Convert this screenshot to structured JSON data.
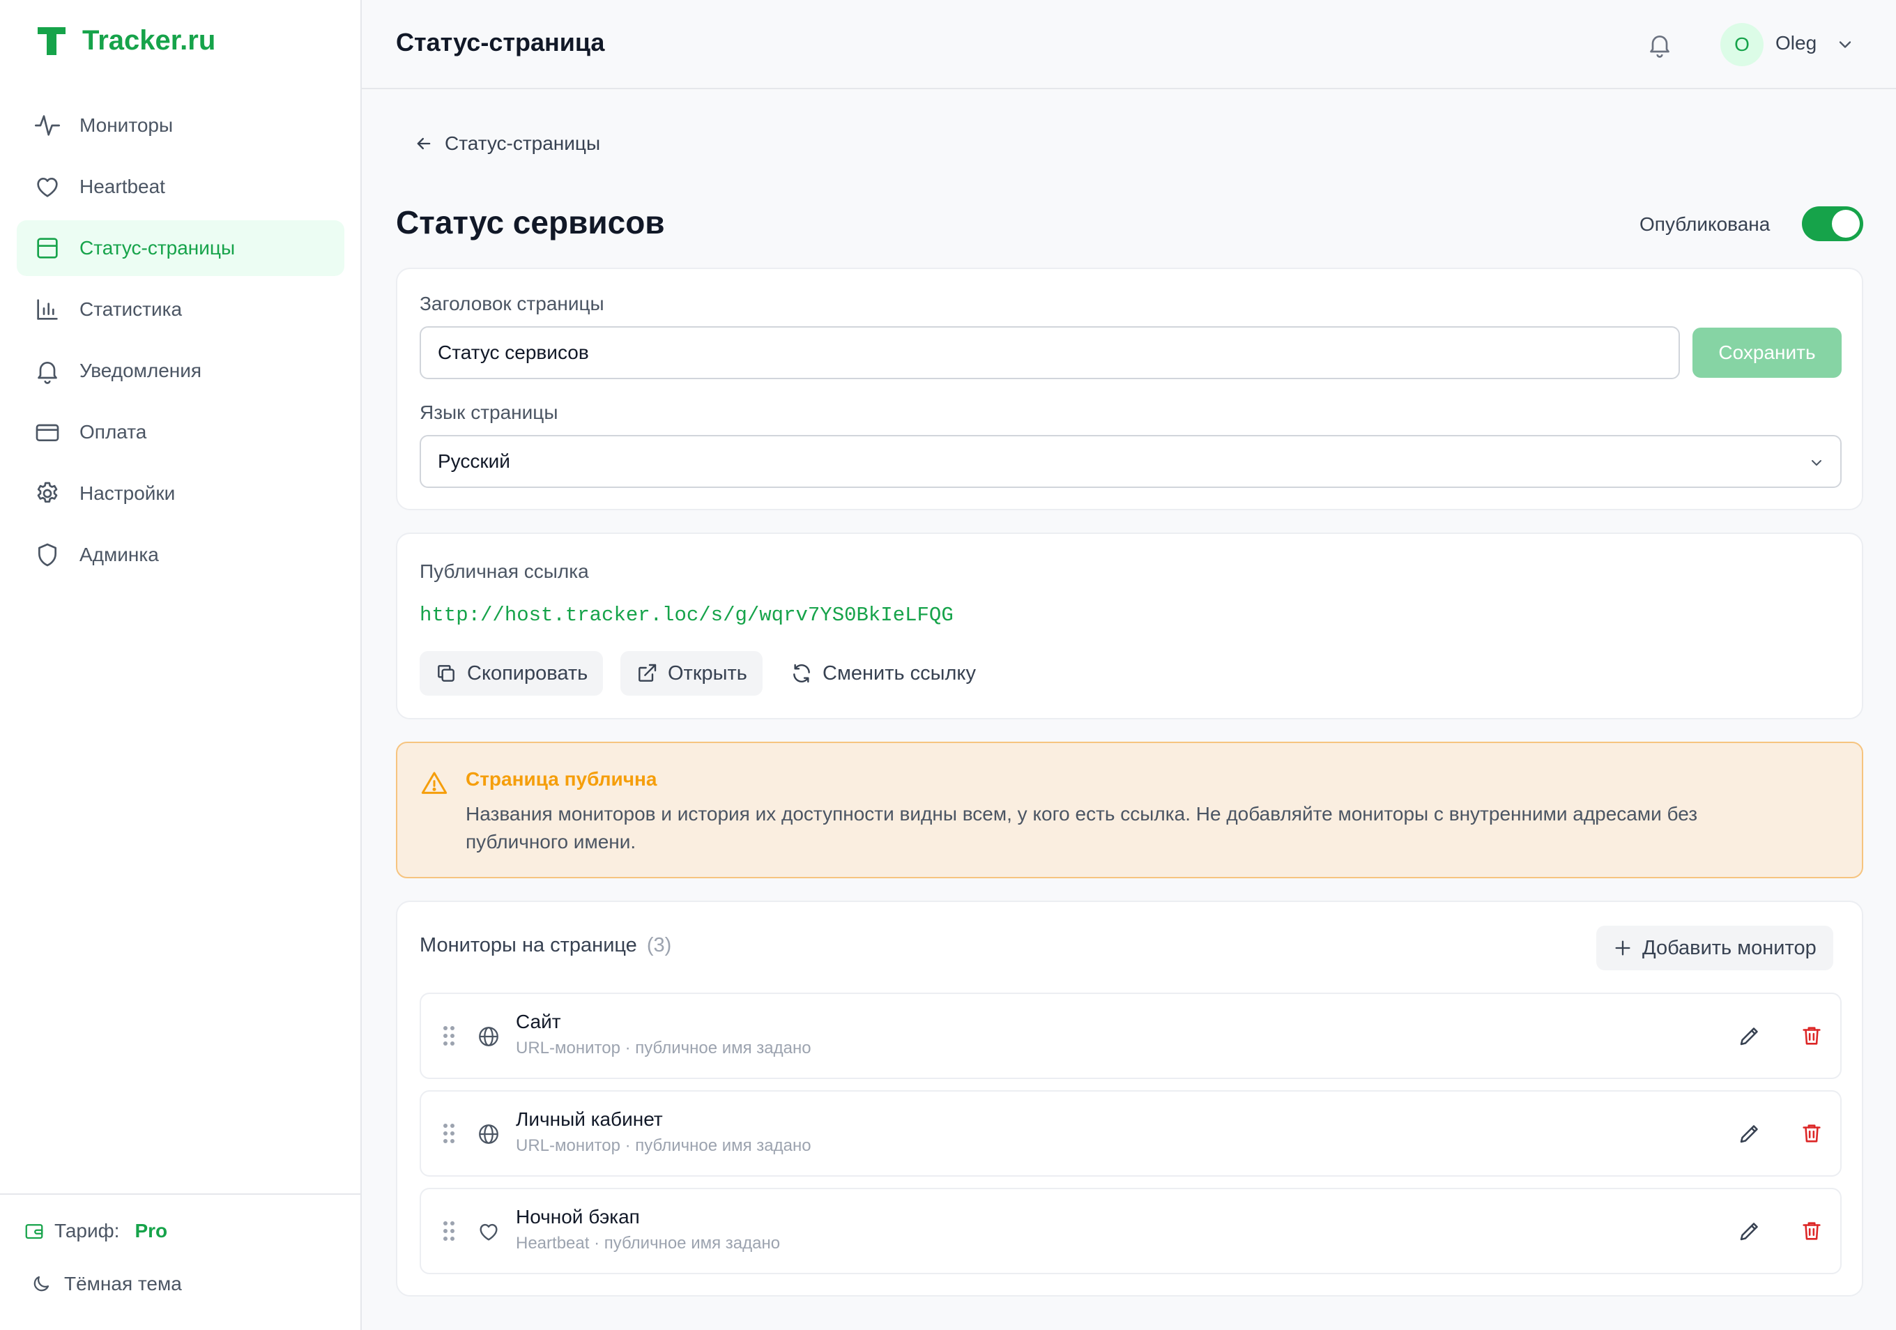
{
  "app": {
    "logo_letter": "T",
    "logo_text": "Tracker.ru",
    "accent_color": "#16a34a"
  },
  "sidebar": {
    "items": [
      {
        "label": "Мониторы",
        "icon": "activity-icon"
      },
      {
        "label": "Heartbeat",
        "icon": "heart-icon"
      },
      {
        "label": "Статус-страницы",
        "icon": "layout-icon",
        "active": true
      },
      {
        "label": "Статистика",
        "icon": "bar-chart-icon"
      },
      {
        "label": "Уведомления",
        "icon": "bell-icon"
      },
      {
        "label": "Оплата",
        "icon": "credit-card-icon"
      },
      {
        "label": "Настройки",
        "icon": "gear-icon"
      },
      {
        "label": "Админка",
        "icon": "shield-icon"
      }
    ],
    "plan_label": "Тариф:",
    "plan_value": "Pro",
    "theme_label": "Тёмная тема"
  },
  "header": {
    "title": "Статус-страница",
    "user_initial": "O",
    "user_name": "Oleg"
  },
  "main": {
    "back_label": "Статус-страницы",
    "page_title": "Статус сервисов",
    "published_label": "Опубликована",
    "published": true,
    "settings": {
      "title_label": "Заголовок страницы",
      "title_value": "Статус сервисов",
      "save_label": "Сохранить",
      "lang_label": "Язык страницы",
      "lang_value": "Русский"
    },
    "public_link": {
      "label": "Публичная ссылка",
      "url": "http://host.tracker.loc/s/g/wqrv7YS0BkIeLFQG",
      "copy_label": "Скопировать",
      "open_label": "Открыть",
      "regenerate_label": "Сменить ссылку"
    },
    "warning": {
      "title": "Страница публична",
      "text": "Названия мониторов и история их доступности видны всем, у кого есть ссылка. Не добавляйте мониторы с внутренними адресами без публичного имени."
    },
    "monitors": {
      "title": "Мониторы на странице",
      "count": "(3)",
      "add_label": "Добавить монитор",
      "rows": [
        {
          "name": "Сайт",
          "sub": "URL-монитор · публичное имя задано",
          "icon": "globe-icon"
        },
        {
          "name": "Личный кабинет",
          "sub": "URL-монитор · публичное имя задано",
          "icon": "globe-icon"
        },
        {
          "name": "Ночной бэкап",
          "sub": "Heartbeat · публичное имя задано",
          "icon": "heart-icon"
        }
      ]
    }
  }
}
